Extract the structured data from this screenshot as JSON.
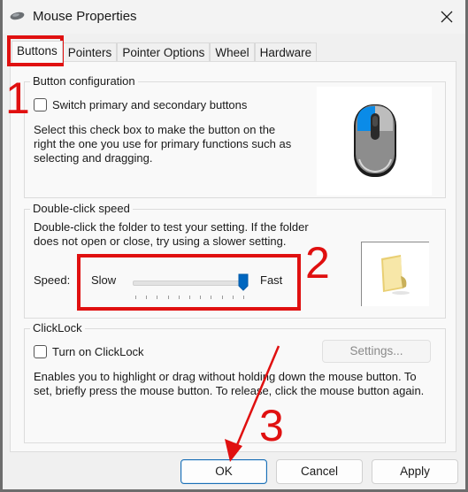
{
  "window": {
    "title": "Mouse Properties",
    "app_icon": "mouse-icon",
    "close_icon": "close-icon"
  },
  "tabs": [
    {
      "label": "Buttons",
      "active": true
    },
    {
      "label": "Pointers",
      "active": false
    },
    {
      "label": "Pointer Options",
      "active": false
    },
    {
      "label": "Wheel",
      "active": false
    },
    {
      "label": "Hardware",
      "active": false
    }
  ],
  "button_configuration": {
    "legend": "Button configuration",
    "checkbox_label": "Switch primary and secondary buttons",
    "checked": false,
    "description": "Select this check box to make the button on the right the one you use for primary functions such as selecting and dragging.",
    "preview_icon": "mouse-preview-icon"
  },
  "double_click_speed": {
    "legend": "Double-click speed",
    "description": "Double-click the folder to test your setting. If the folder does not open or close, try using a slower setting.",
    "speed_label": "Speed:",
    "slow_label": "Slow",
    "fast_label": "Fast",
    "slider_value": 10,
    "slider_min": 0,
    "slider_max": 10,
    "test_icon": "folder-icon"
  },
  "clicklock": {
    "legend": "ClickLock",
    "checkbox_label": "Turn on ClickLock",
    "checked": false,
    "settings_button": "Settings...",
    "description": "Enables you to highlight or drag without holding down the mouse button. To set, briefly press the mouse button. To release, click the mouse button again."
  },
  "footer": {
    "ok": "OK",
    "cancel": "Cancel",
    "apply": "Apply"
  },
  "annotations": {
    "step1": "1",
    "step2": "2",
    "step3": "3",
    "color": "#e01010"
  }
}
